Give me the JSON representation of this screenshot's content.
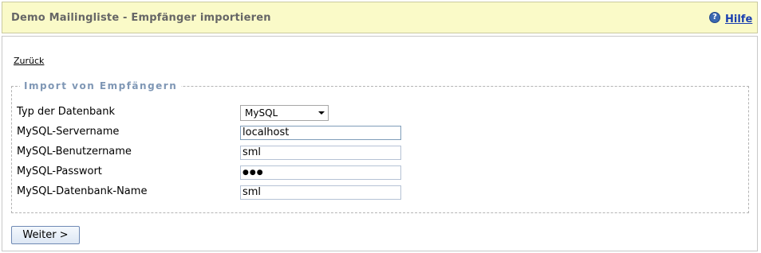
{
  "header": {
    "title": "Demo Mailingliste - Empfänger importieren",
    "help_icon_glyph": "?",
    "help_label": "Hilfe"
  },
  "nav": {
    "back_label": "Zurück"
  },
  "form": {
    "legend": "Import von Empfängern",
    "fields": [
      {
        "label": "Typ der Datenbank",
        "value": "MySQL",
        "kind": "select"
      },
      {
        "label": "MySQL-Servername",
        "value": "localhost",
        "kind": "text"
      },
      {
        "label": "MySQL-Benutzername",
        "value": "sml",
        "kind": "text"
      },
      {
        "label": "MySQL-Passwort",
        "value": "●●●",
        "kind": "password"
      },
      {
        "label": "MySQL-Datenbank-Name",
        "value": "sml",
        "kind": "text"
      }
    ],
    "submit_label": "Weiter >"
  },
  "colors": {
    "header_bg": "#fafac8",
    "title_text": "#666666",
    "legend_text": "#7f97b5",
    "link_blue": "#1a3fb0"
  }
}
